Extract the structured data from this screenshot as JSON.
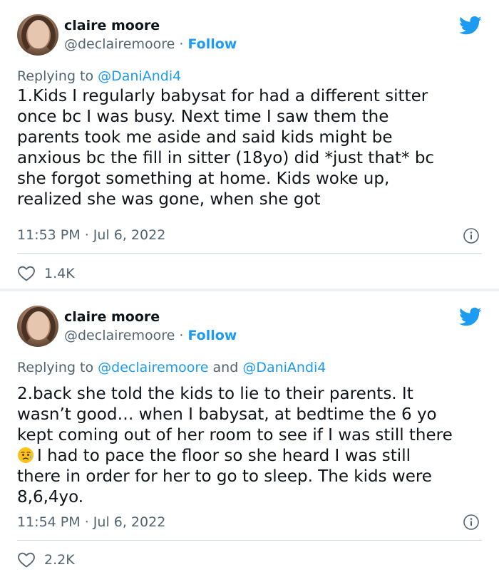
{
  "tweets": [
    {
      "author_name": "claire moore",
      "handle": "@declairemoore",
      "separator": "·",
      "follow_label": "Follow",
      "replying_prefix": "Replying to ",
      "replying_mentions": "@DaniAndi4",
      "body": "1.Kids I regularly babysat for had a different sitter\nonce bc I was busy. Next time I saw them the\nparents took me aside and said kids might be\nanxious bc the fill in sitter (18yo) did *just that* bc\nshe forgot something at home. Kids woke up,\nrealized she was gone, when she got",
      "time": "11:53 PM",
      "date": "Jul 6, 2022",
      "likes": "1.4K"
    },
    {
      "author_name": "claire moore",
      "handle": "@declairemoore",
      "separator": "·",
      "follow_label": "Follow",
      "replying_prefix": "Replying to ",
      "replying_mention_1": "@declairemoore",
      "replying_and": " and ",
      "replying_mention_2": "@DaniAndi4",
      "body_before_emoji": "2.back she told the kids to lie to their parents. It\nwasn’t good… when I babysat, at bedtime the 6 yo\nkept coming out of her room to see if I was still there\n",
      "body_after_emoji": "I had to pace the floor so she heard I was still\nthere in order for her to go to sleep. The kids were\n8,6,4yo.",
      "emoji": "sad-but-relieved-face-emoji",
      "time": "11:54 PM",
      "date": "Jul 6, 2022",
      "likes": "2.2K"
    }
  ],
  "colors": {
    "link": "#1d9bf0",
    "secondary_text": "#536471",
    "primary_text": "#0f1419",
    "divider": "#cfd9de"
  },
  "icons": [
    "twitter-bird-icon",
    "info-icon",
    "heart-icon"
  ]
}
